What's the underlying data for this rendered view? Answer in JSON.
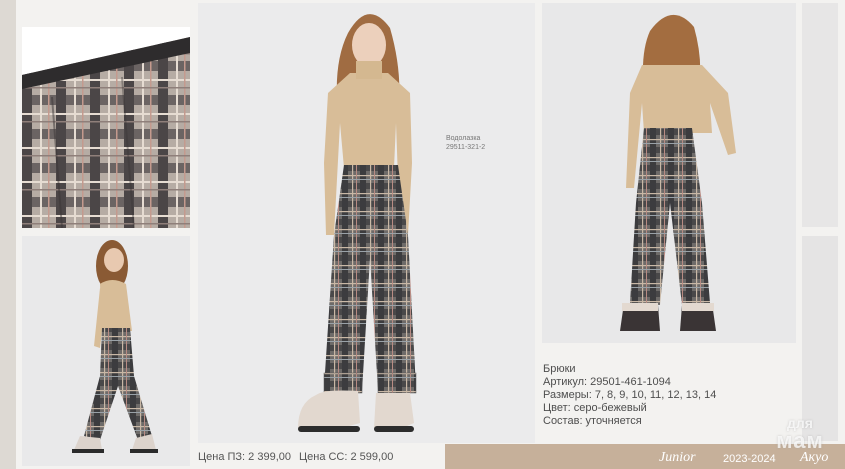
{
  "product": {
    "name": "Брюки",
    "article": "Артикул: 29501-461-1094",
    "sizes": "Размеры: 7, 8, 9, 10, 11, 12, 13, 14",
    "color": "Цвет: серо-бежевый",
    "composition": "Состав: уточняется"
  },
  "related_item": {
    "name": "Водолазка",
    "code": "29511-321-2"
  },
  "prices": {
    "pz": "Цена ПЗ: 2 399,00",
    "ss": "Цена СС: 2 599,00"
  },
  "brand": {
    "collection": "Junior",
    "season": "2023-2024",
    "mark": "Акуо"
  },
  "watermark": {
    "line1": "для",
    "line2": "мам"
  },
  "colors": {
    "background": "#f3f2f0",
    "band": "#c6b09a",
    "sweater": "#d8bd98",
    "plaid_dark": "#4a4a4c",
    "plaid_light": "#a49a90"
  },
  "images": [
    {
      "name": "fabric-closeup-photo"
    },
    {
      "name": "side-walking-photo"
    },
    {
      "name": "front-view-photo"
    },
    {
      "name": "back-view-photo"
    }
  ]
}
